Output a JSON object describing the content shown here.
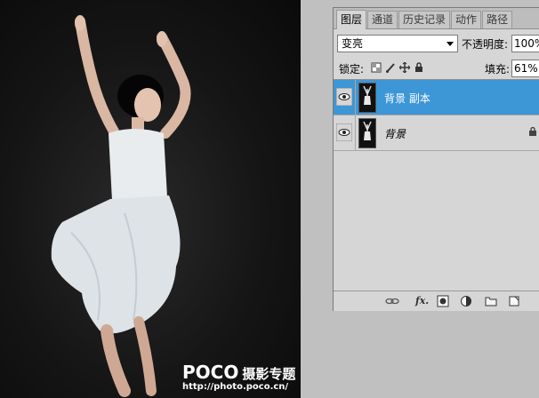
{
  "watermark": {
    "brand": "POCO",
    "brand_zh": "摄影专题",
    "url": "http://photo.poco.cn/"
  },
  "panel": {
    "tabs": [
      {
        "label": "图层",
        "active": true
      },
      {
        "label": "通道",
        "active": false
      },
      {
        "label": "历史记录",
        "active": false
      },
      {
        "label": "动作",
        "active": false
      },
      {
        "label": "路径",
        "active": false
      }
    ],
    "blend_mode": "变亮",
    "opacity_label": "不透明度:",
    "opacity_value": "100%",
    "lock_label": "锁定:",
    "fill_label": "填充:",
    "fill_value": "61%",
    "layers": [
      {
        "name": "背景 副本",
        "selected": true,
        "visible": true,
        "locked": false
      },
      {
        "name": "背景",
        "selected": false,
        "visible": true,
        "locked": true
      }
    ],
    "footer_icons": [
      "link-icon",
      "fx-icon",
      "mask-icon",
      "adjustment-icon",
      "folder-icon",
      "new-layer-icon"
    ]
  },
  "colors": {
    "selected_layer": "#3d96d6",
    "panel_bg": "#d6d6d6",
    "workspace_bg": "#c0c0c0"
  }
}
